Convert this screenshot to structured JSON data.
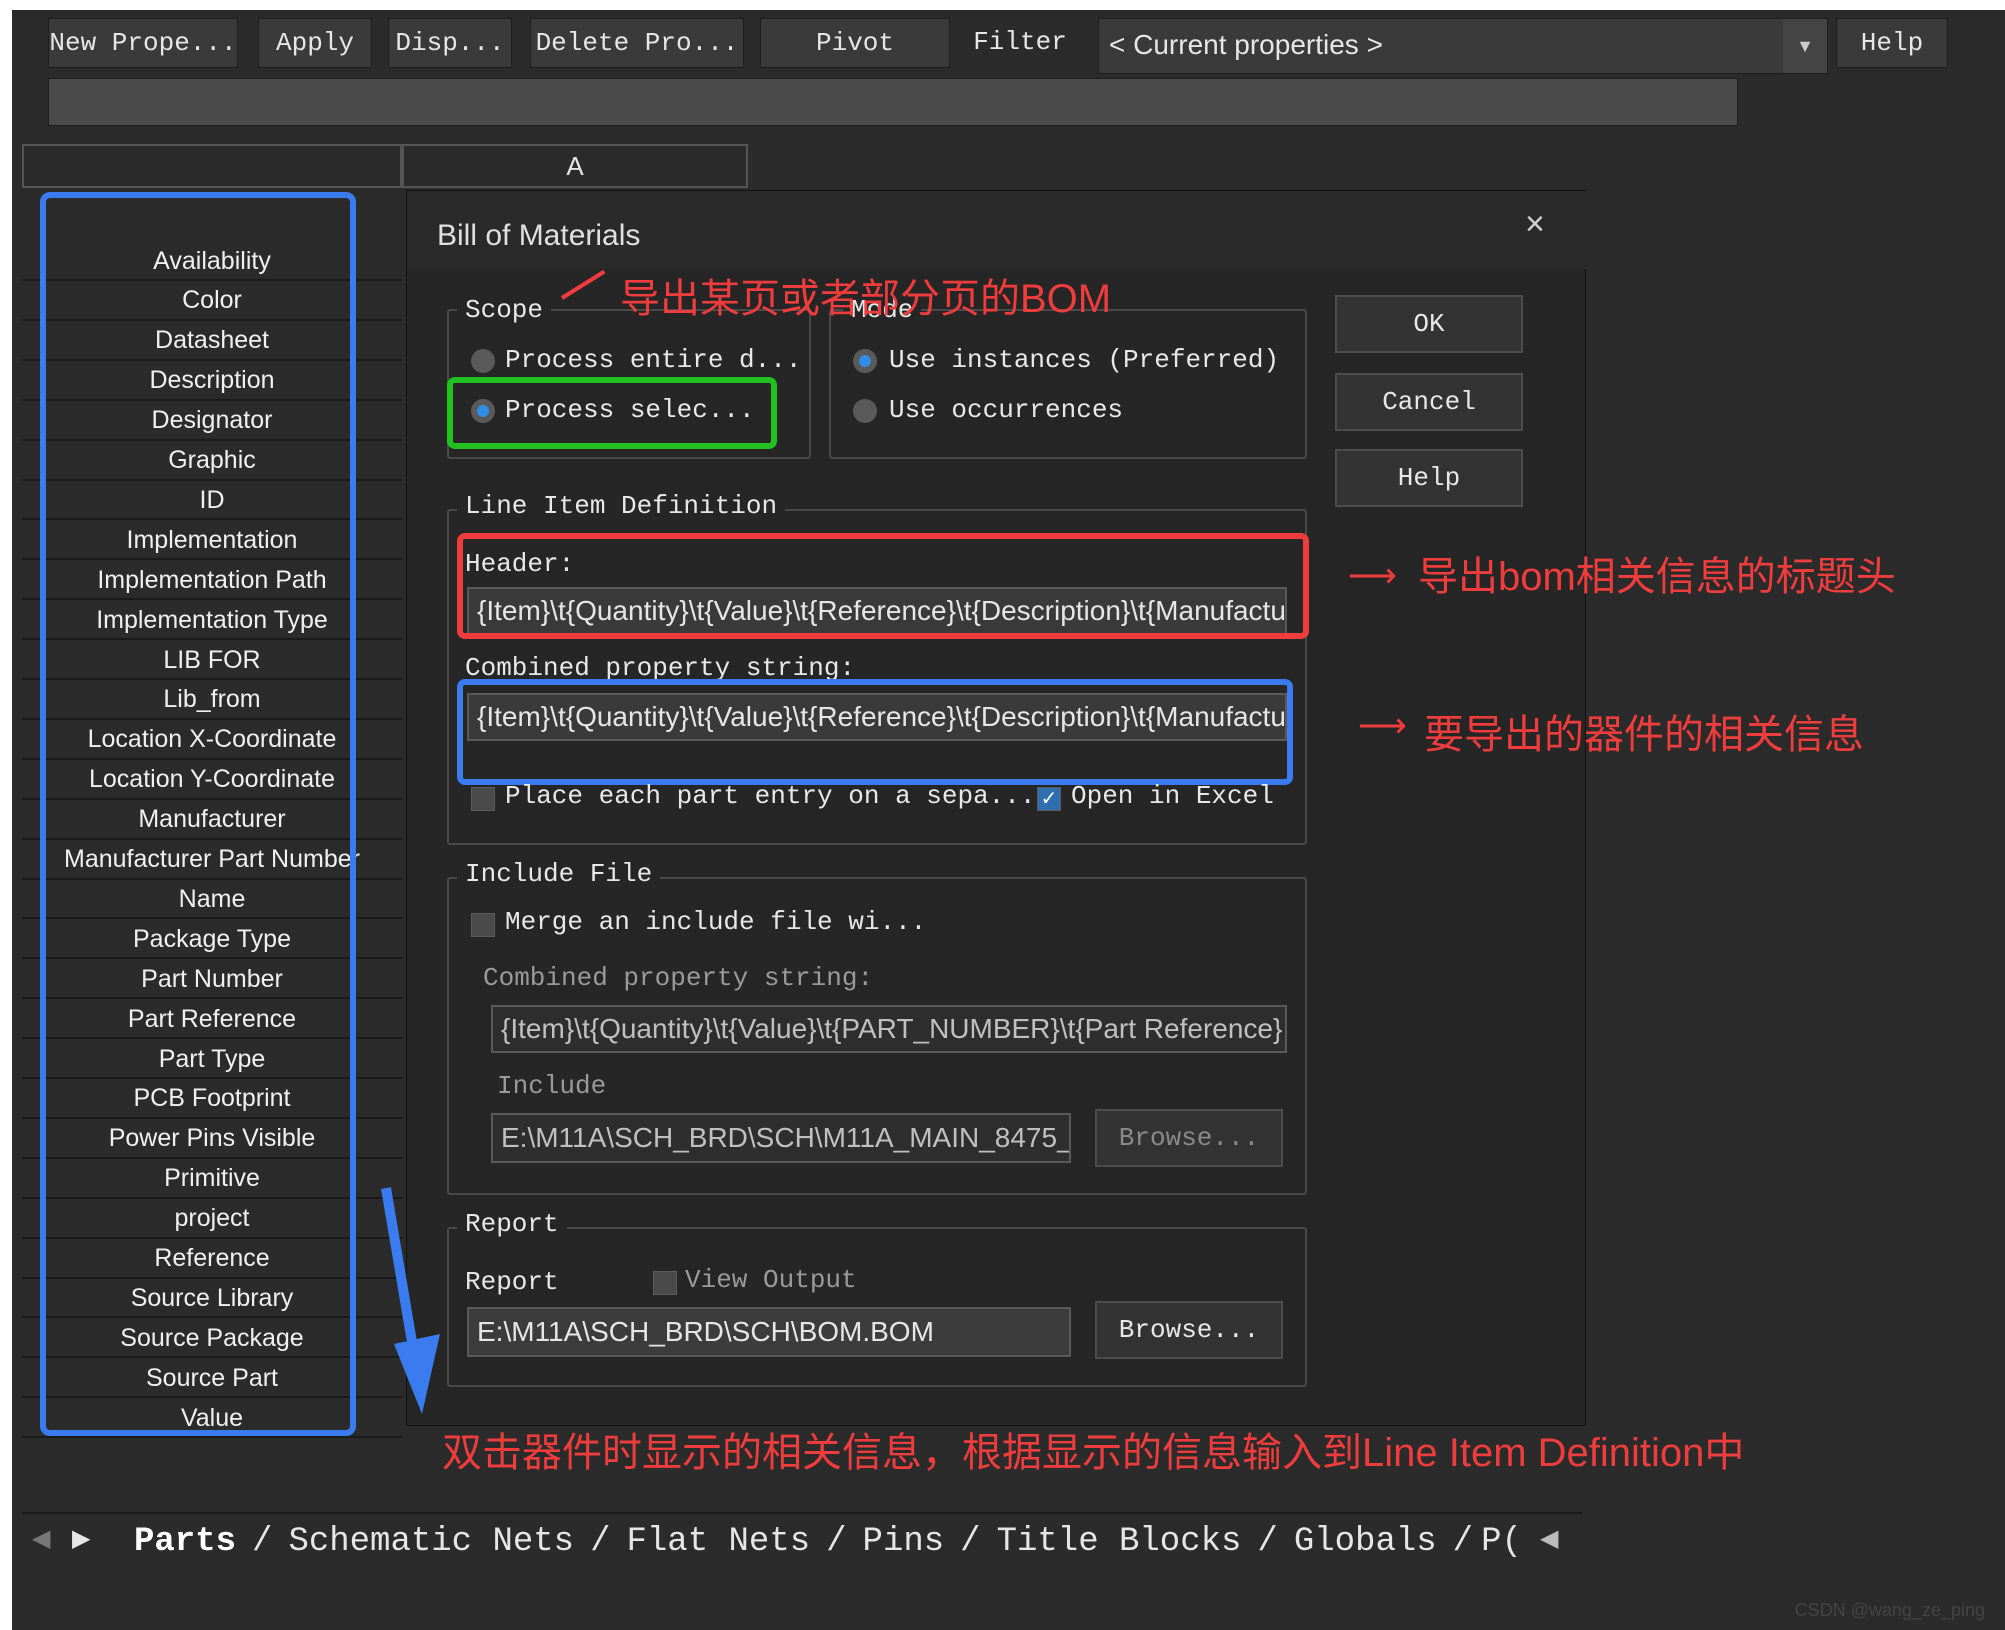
{
  "toolbar": {
    "new_property": "New Prope...",
    "apply": "Apply",
    "display": "Disp...",
    "delete_property": "Delete Pro...",
    "pivot": "Pivot",
    "filter": "Filter",
    "filter_value": "< Current properties >",
    "help": "Help"
  },
  "grid": {
    "column_a": "A",
    "properties": [
      "Availability",
      "Color",
      "Datasheet",
      "Description",
      "Designator",
      "Graphic",
      "ID",
      "Implementation",
      "Implementation Path",
      "Implementation Type",
      "LIB FOR",
      "Lib_from",
      "Location X-Coordinate",
      "Location Y-Coordinate",
      "Manufacturer",
      "Manufacturer Part Number",
      "Name",
      "Package Type",
      "Part Number",
      "Part Reference",
      "Part Type",
      "PCB Footprint",
      "Power Pins Visible",
      "Primitive",
      "project",
      "Reference",
      "Source Library",
      "Source Package",
      "Source Part",
      "Value"
    ]
  },
  "dialog": {
    "title": "Bill of Materials",
    "close": "×",
    "scope": {
      "label": "Scope",
      "entire": "Process entire d...",
      "selection": "Process selec..."
    },
    "mode": {
      "label": "Mode",
      "instances": "Use instances (Preferred)",
      "occurrences": "Use occurrences"
    },
    "buttons": {
      "ok": "OK",
      "cancel": "Cancel",
      "help": "Help"
    },
    "line_item": {
      "label": "Line Item Definition",
      "header_label": "Header:",
      "header_value": "{Item}\\t{Quantity}\\t{Value}\\t{Reference}\\t{Description}\\t{Manufactu",
      "combined_label": "Combined property string:",
      "combined_value": "{Item}\\t{Quantity}\\t{Value}\\t{Reference}\\t{Description}\\t{Manufactu",
      "place_each": "Place each part entry on a sepa...",
      "open_excel": "Open in Excel"
    },
    "include_file": {
      "label": "Include File",
      "merge": "Merge an include file wi...",
      "combined_label": "Combined property string:",
      "combined_value": "{Item}\\t{Quantity}\\t{Value}\\t{PART_NUMBER}\\t{Part Reference}",
      "include_label": "Include",
      "include_value": "E:\\M11A\\SCH_BRD\\SCH\\M11A_MAIN_8475_",
      "browse": "Browse..."
    },
    "report": {
      "label": "Report",
      "report_label": "Report",
      "view_output": "View Output",
      "report_value": "E:\\M11A\\SCH_BRD\\SCH\\BOM.BOM",
      "browse": "Browse..."
    }
  },
  "annotations": {
    "scope_note": "导出某页或者部分页的BOM",
    "header_note": "导出bom相关信息的标题头",
    "combined_note": "要导出的器件的相关信息",
    "bottom_note": "双击器件时显示的相关信息，根据显示的信息输入到Line Item Definition中"
  },
  "tabs": [
    "Parts",
    "Schematic Nets",
    "Flat Nets",
    "Pins",
    "Title Blocks",
    "Globals",
    "P("
  ],
  "watermark": "CSDN @wang_ze_ping",
  "colors": {
    "background": "#2b2b2b",
    "annotation_red": "#ef3c3c",
    "highlight_blue": "#3a7cf0",
    "highlight_green": "#22c122",
    "radio_selected": "#2f8fe6"
  }
}
